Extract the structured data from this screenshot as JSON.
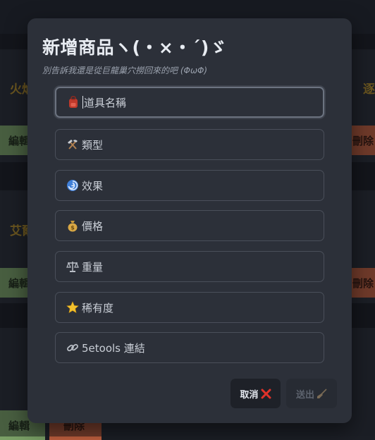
{
  "background": {
    "cards": [
      {
        "name_left": "火焰",
        "name_right": "逐",
        "edit_label": "編輯",
        "delete_label": "刪除"
      },
      {
        "name_left": "艾爾",
        "edit_label": "編輯",
        "delete_label": "刪除"
      },
      {
        "edit_label": "編輯",
        "delete_label": "刪除"
      }
    ]
  },
  "modal": {
    "title": "新增商品ヽ(・×・´)ゞ",
    "subtitle": "別告訴我還是從巨龍巢穴撈回來的吧 (ΦωΦ)",
    "fields": [
      {
        "icon": "backpack-icon",
        "placeholder": "道具名稱",
        "focused": true
      },
      {
        "icon": "hammer-pick-icon",
        "placeholder": "類型"
      },
      {
        "icon": "cyclone-icon",
        "placeholder": "效果"
      },
      {
        "icon": "money-bag-icon",
        "placeholder": "價格"
      },
      {
        "icon": "scales-icon",
        "placeholder": "重量"
      },
      {
        "icon": "star-icon",
        "placeholder": "稀有度"
      },
      {
        "icon": "link-icon",
        "placeholder": "5etools 連結"
      }
    ],
    "cancel_label": "取消",
    "submit_label": "送出"
  },
  "colors": {
    "accent_gold": "#b8912a",
    "edit_green": "#7aa066",
    "delete_red": "#c2603f",
    "modal_bg": "#2c3039"
  }
}
